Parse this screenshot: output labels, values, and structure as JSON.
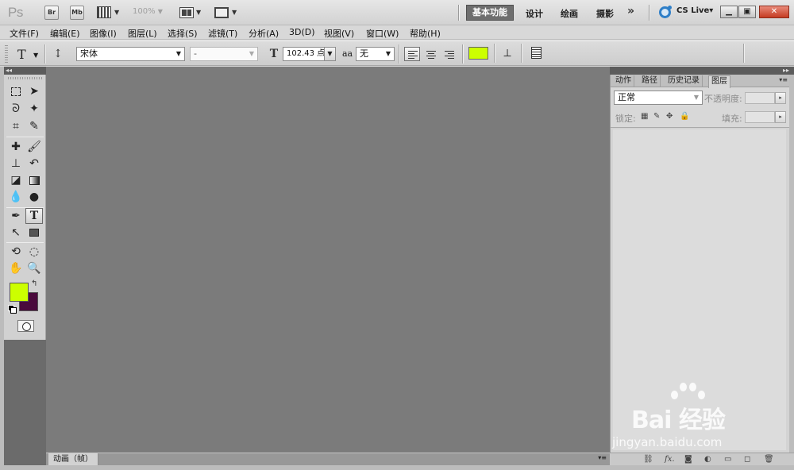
{
  "app": {
    "logo": "Ps",
    "bridge_label": "Br",
    "minibridge_label": "Mb",
    "zoom": "100%"
  },
  "workspaces": {
    "active": "基本功能",
    "items": [
      "设计",
      "绘画",
      "摄影"
    ],
    "more": "»"
  },
  "cslive": {
    "label": "CS Live▾"
  },
  "menu": {
    "items": [
      "文件(F)",
      "编辑(E)",
      "图像(I)",
      "图层(L)",
      "选择(S)",
      "滤镜(T)",
      "分析(A)",
      "3D(D)",
      "视图(V)",
      "窗口(W)",
      "帮助(H)"
    ]
  },
  "options": {
    "tool_preset": "T",
    "font_family": "宋体",
    "font_style": "-",
    "font_size": "102.43 点",
    "antialias_label": "aa",
    "antialias_value": "无",
    "text_color": "#ccff00"
  },
  "tools": {
    "foreground": "#ccff00",
    "background": "#4a0a3c"
  },
  "animation": {
    "tab_label": "动画（帧）"
  },
  "layers_panel": {
    "tabs": [
      "动作",
      "路径",
      "历史记录",
      "图层"
    ],
    "active_tab": "图层",
    "blend_mode": "正常",
    "opacity_label": "不透明度:",
    "lock_label": "锁定:",
    "fill_label": "填充:"
  },
  "watermark": {
    "brand": "Bai 经验",
    "url": "jingyan.baidu.com"
  }
}
